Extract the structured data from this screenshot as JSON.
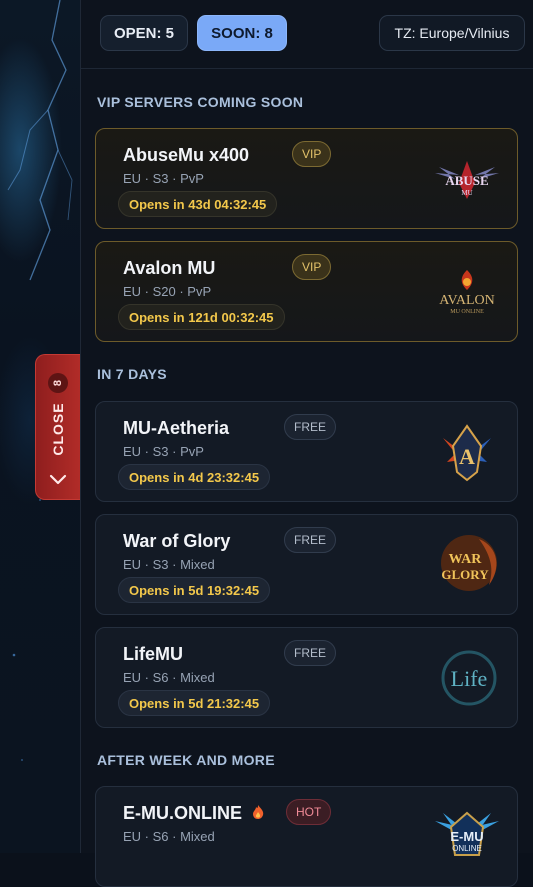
{
  "topbar": {
    "open_label": "OPEN: 5",
    "soon_label": "SOON: 8",
    "timezone_label": "TZ: Europe/Vilnius"
  },
  "side_tab": {
    "label": "CLOSE",
    "count": "8"
  },
  "sections": [
    {
      "title": "VIP SERVERS COMING SOON",
      "cards": [
        {
          "name": "AbuseMu x400",
          "meta": "EU · S3 · PvP",
          "timer": "Opens in 43d 04:32:45",
          "badge": "VIP",
          "logo_icon": "abusemu-logo-icon"
        },
        {
          "name": "Avalon MU",
          "meta": "EU · S20 · PvP",
          "timer": "Opens in 121d 00:32:45",
          "badge": "VIP",
          "logo_icon": "avalon-logo-icon"
        }
      ]
    },
    {
      "title": "IN 7 DAYS",
      "cards": [
        {
          "name": "MU-Aetheria",
          "meta": "EU · S3 · PvP",
          "timer": "Opens in 4d 23:32:45",
          "badge": "FREE",
          "logo_icon": "aetheria-logo-icon"
        },
        {
          "name": "War of Glory",
          "meta": "EU · S3 · Mixed",
          "timer": "Opens in 5d 19:32:45",
          "badge": "FREE",
          "logo_icon": "war-of-glory-logo-icon"
        },
        {
          "name": "LifeMU",
          "meta": "EU · S6 · Mixed",
          "timer": "Opens in 5d 21:32:45",
          "badge": "FREE",
          "logo_icon": "lifemu-logo-icon"
        }
      ]
    },
    {
      "title": "AFTER WEEK AND MORE",
      "cards": [
        {
          "name": "E-MU.ONLINE",
          "meta": "EU · S6 · Mixed",
          "timer": "",
          "badge": "HOT",
          "logo_icon": "emu-online-logo-icon",
          "name_icon": "fire-icon"
        }
      ]
    }
  ],
  "logo_text": {
    "abusemu": "ABUSE",
    "abusemu_sub": "MU",
    "avalon": "AVALON",
    "avalon_sub": "MU ONLINE",
    "aetheria": "A",
    "war_of_glory_1": "WAR",
    "war_of_glory_2": "GLORY",
    "lifemu": "Life",
    "emu": "E-MU",
    "emu_sub": "ONLINE"
  },
  "colors": {
    "accent_blue": "#7aa9f7",
    "timer_gold": "#f3c84b",
    "vip_border": "#6d5b2a",
    "close_red": "#b12c28"
  }
}
